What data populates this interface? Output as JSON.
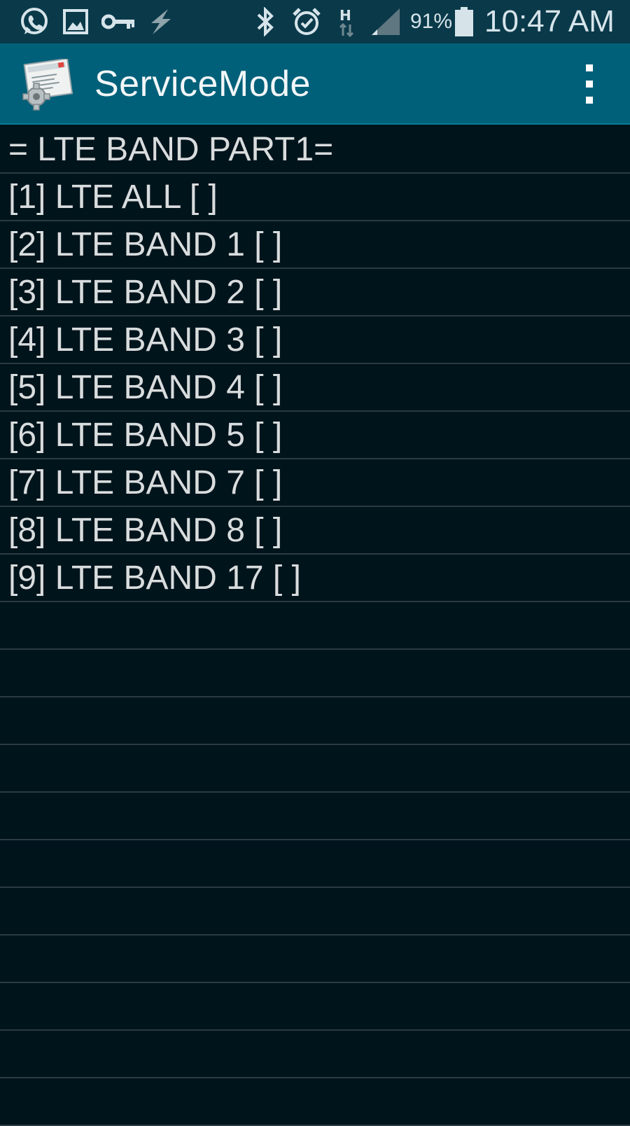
{
  "status_bar": {
    "icons": [
      "whatsapp-icon",
      "gallery-icon",
      "key-icon",
      "flash-icon",
      "bluetooth-icon",
      "alarm-icon",
      "h-data-icon",
      "signal-icon",
      "battery-icon"
    ],
    "battery_percent": "91%",
    "time": "10:47 AM"
  },
  "app_bar": {
    "title": "ServiceMode"
  },
  "list": {
    "items": [
      "= LTE BAND PART1=",
      "[1] LTE ALL [ ]",
      "[2] LTE BAND 1 [ ]",
      "[3] LTE BAND 2 [ ]",
      "[4] LTE BAND 3 [ ]",
      "[5] LTE BAND 4 [ ]",
      "[6] LTE BAND 5 [ ]",
      "[7] LTE BAND 7 [ ]",
      "[8] LTE BAND 8 [ ]",
      "[9] LTE BAND 17 [ ]",
      "",
      "",
      "",
      "",
      "",
      "",
      "",
      "",
      "",
      "",
      ""
    ]
  },
  "colors": {
    "status_bar_bg": "#0a3a4a",
    "app_bar_bg": "#006079",
    "list_bg": "#00141c",
    "divider": "#2a3b42",
    "text": "#d9dcdd"
  }
}
